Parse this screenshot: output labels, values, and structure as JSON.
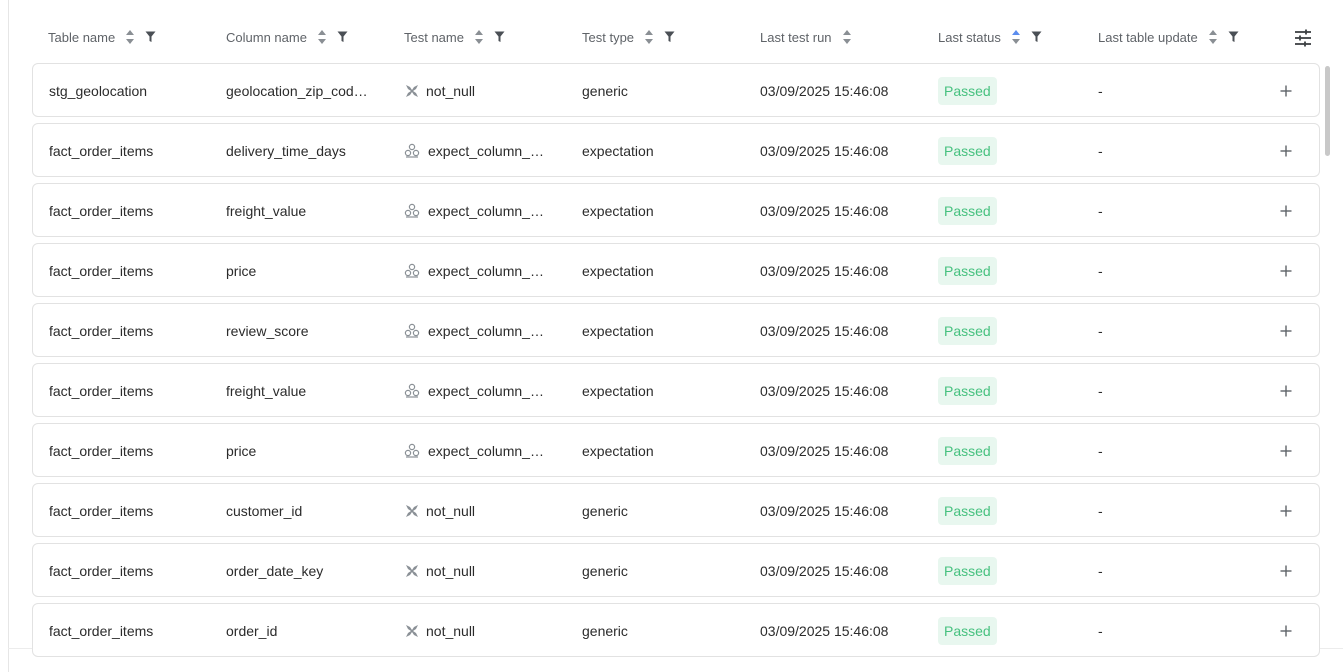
{
  "columns": [
    {
      "label": "Table name",
      "sortable": true,
      "filterable": true,
      "sort_active": false
    },
    {
      "label": "Column name",
      "sortable": true,
      "filterable": true,
      "sort_active": false
    },
    {
      "label": "Test name",
      "sortable": true,
      "filterable": true,
      "sort_active": false
    },
    {
      "label": "Test type",
      "sortable": true,
      "filterable": true,
      "sort_active": false
    },
    {
      "label": "Last test run",
      "sortable": true,
      "filterable": false,
      "sort_active": false
    },
    {
      "label": "Last status",
      "sortable": true,
      "filterable": true,
      "sort_active": true
    },
    {
      "label": "Last table update",
      "sortable": true,
      "filterable": true,
      "sort_active": false
    }
  ],
  "colors": {
    "passed_bg": "#e8f7ef",
    "passed_text": "#46c17f",
    "sort_active": "#5b8def",
    "icon_gray": "#5f6368"
  },
  "icons": {
    "sort": "sort-updown-icon",
    "filter": "filter-funnel-icon",
    "settings": "column-settings-sliders-icon",
    "generic_test": "dbt-generic-test-icon",
    "expectation_test": "great-expectations-icon",
    "expand": "plus-icon"
  },
  "rows": [
    {
      "table": "stg_geolocation",
      "column": "geolocation_zip_cod…",
      "test_name": "not_null",
      "test_icon": "generic",
      "test_type": "generic",
      "last_run": "03/09/2025 15:46:08",
      "status": "Passed",
      "last_update": "-"
    },
    {
      "table": "fact_order_items",
      "column": "delivery_time_days",
      "test_name": "expect_column_…",
      "test_icon": "expectation",
      "test_type": "expectation",
      "last_run": "03/09/2025 15:46:08",
      "status": "Passed",
      "last_update": "-"
    },
    {
      "table": "fact_order_items",
      "column": "freight_value",
      "test_name": "expect_column_…",
      "test_icon": "expectation",
      "test_type": "expectation",
      "last_run": "03/09/2025 15:46:08",
      "status": "Passed",
      "last_update": "-"
    },
    {
      "table": "fact_order_items",
      "column": "price",
      "test_name": "expect_column_…",
      "test_icon": "expectation",
      "test_type": "expectation",
      "last_run": "03/09/2025 15:46:08",
      "status": "Passed",
      "last_update": "-"
    },
    {
      "table": "fact_order_items",
      "column": "review_score",
      "test_name": "expect_column_…",
      "test_icon": "expectation",
      "test_type": "expectation",
      "last_run": "03/09/2025 15:46:08",
      "status": "Passed",
      "last_update": "-"
    },
    {
      "table": "fact_order_items",
      "column": "freight_value",
      "test_name": "expect_column_…",
      "test_icon": "expectation",
      "test_type": "expectation",
      "last_run": "03/09/2025 15:46:08",
      "status": "Passed",
      "last_update": "-"
    },
    {
      "table": "fact_order_items",
      "column": "price",
      "test_name": "expect_column_…",
      "test_icon": "expectation",
      "test_type": "expectation",
      "last_run": "03/09/2025 15:46:08",
      "status": "Passed",
      "last_update": "-"
    },
    {
      "table": "fact_order_items",
      "column": "customer_id",
      "test_name": "not_null",
      "test_icon": "generic",
      "test_type": "generic",
      "last_run": "03/09/2025 15:46:08",
      "status": "Passed",
      "last_update": "-"
    },
    {
      "table": "fact_order_items",
      "column": "order_date_key",
      "test_name": "not_null",
      "test_icon": "generic",
      "test_type": "generic",
      "last_run": "03/09/2025 15:46:08",
      "status": "Passed",
      "last_update": "-"
    },
    {
      "table": "fact_order_items",
      "column": "order_id",
      "test_name": "not_null",
      "test_icon": "generic",
      "test_type": "generic",
      "last_run": "03/09/2025 15:46:08",
      "status": "Passed",
      "last_update": "-"
    }
  ]
}
